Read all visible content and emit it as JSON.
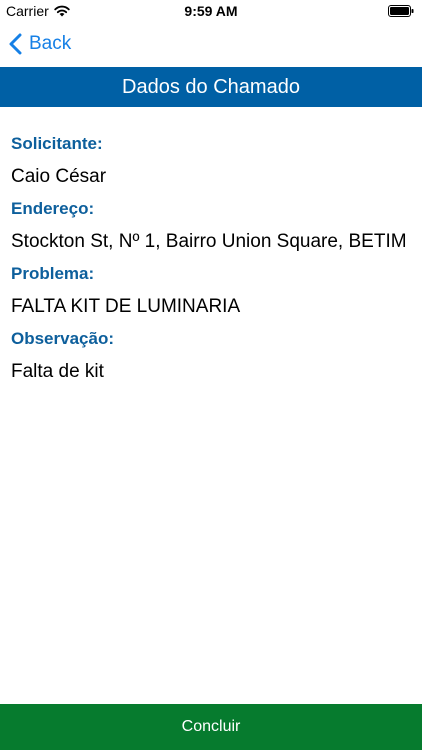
{
  "status_bar": {
    "carrier": "Carrier",
    "time": "9:59 AM",
    "wifi_icon": "wifi-icon",
    "battery_icon": "battery-full-icon"
  },
  "nav": {
    "back_label": "Back",
    "back_icon": "chevron-left-icon"
  },
  "header": {
    "title": "Dados do Chamado"
  },
  "details": {
    "requester_label": "Solicitante:",
    "requester_value": "Caio César",
    "address_label": "Endereço:",
    "address_value": "Stockton St, Nº 1, Bairro Union Square, BETIM",
    "problem_label": "Problema:",
    "problem_value": "FALTA KIT DE LUMINARIA",
    "note_label": "Observação:",
    "note_value": "Falta de kit"
  },
  "footer": {
    "conclude_label": "Concluir"
  },
  "colors": {
    "header_background": "#0060a5",
    "label_text": "#0d5f9c",
    "link_text": "#1680e6",
    "conclude_background": "#067b2e"
  }
}
